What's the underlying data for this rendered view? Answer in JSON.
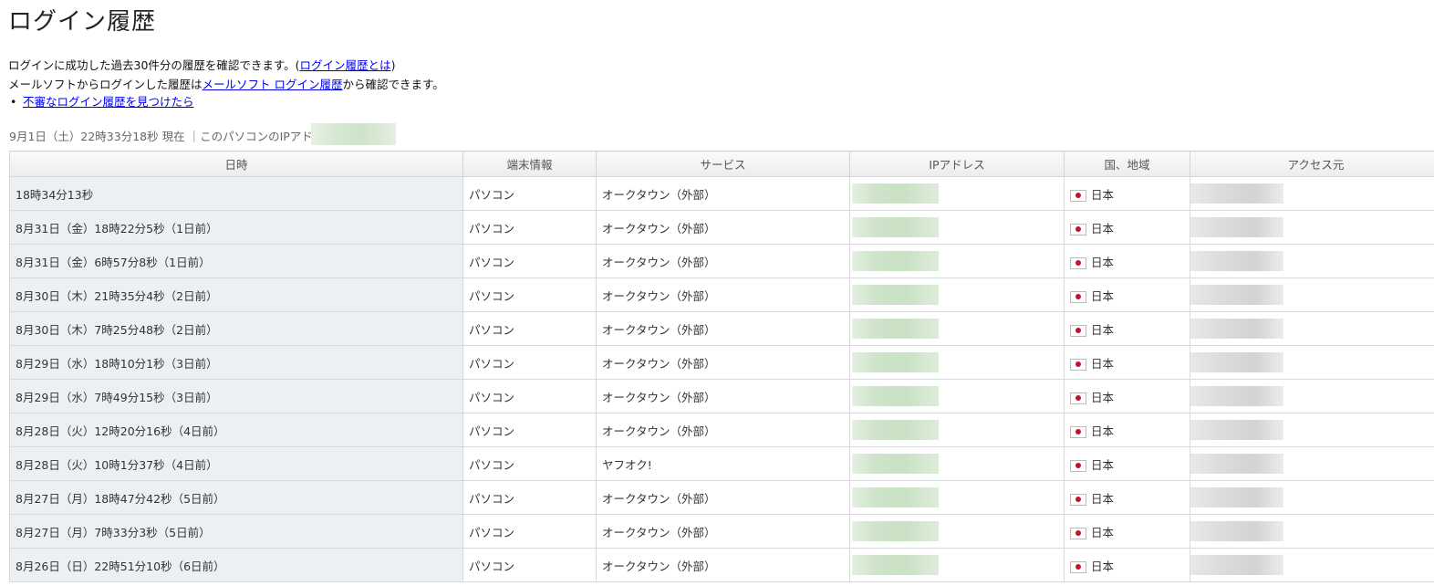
{
  "page_title": "ログイン履歴",
  "intro": {
    "line1_text": "ログインに成功した過去30件分の履歴を確認できます。(",
    "line1_link": "ログイン履歴とは",
    "line1_end": ")",
    "line2_text": "メールソフトからログインした履歴は",
    "line2_link": "メールソフト ログイン履歴",
    "line2_end": "から確認できます。"
  },
  "bullet_link": "不審なログイン履歴を見つけたら",
  "status_line": "9月1日（土）22時33分18秒 現在 ｜このパソコンのIPアドレス：",
  "table": {
    "headers": [
      "日時",
      "端末情報",
      "サービス",
      "IPアドレス",
      "国、地域",
      "アクセス元"
    ],
    "rows": [
      {
        "datetime": "18時34分13秒",
        "device": "パソコン",
        "service": "オークタウン（外部）",
        "country": "日本"
      },
      {
        "datetime": "8月31日（金）18時22分5秒（1日前）",
        "device": "パソコン",
        "service": "オークタウン（外部）",
        "country": "日本"
      },
      {
        "datetime": "8月31日（金）6時57分8秒（1日前）",
        "device": "パソコン",
        "service": "オークタウン（外部）",
        "country": "日本"
      },
      {
        "datetime": "8月30日（木）21時35分4秒（2日前）",
        "device": "パソコン",
        "service": "オークタウン（外部）",
        "country": "日本"
      },
      {
        "datetime": "8月30日（木）7時25分48秒（2日前）",
        "device": "パソコン",
        "service": "オークタウン（外部）",
        "country": "日本"
      },
      {
        "datetime": "8月29日（水）18時10分1秒（3日前）",
        "device": "パソコン",
        "service": "オークタウン（外部）",
        "country": "日本"
      },
      {
        "datetime": "8月29日（水）7時49分15秒（3日前）",
        "device": "パソコン",
        "service": "オークタウン（外部）",
        "country": "日本"
      },
      {
        "datetime": "8月28日（火）12時20分16秒（4日前）",
        "device": "パソコン",
        "service": "オークタウン（外部）",
        "country": "日本"
      },
      {
        "datetime": "8月28日（火）10時1分37秒（4日前）",
        "device": "パソコン",
        "service": "ヤフオク!",
        "country": "日本"
      },
      {
        "datetime": "8月27日（月）18時47分42秒（5日前）",
        "device": "パソコン",
        "service": "オークタウン（外部）",
        "country": "日本"
      },
      {
        "datetime": "8月27日（月）7時33分3秒（5日前）",
        "device": "パソコン",
        "service": "オークタウン（外部）",
        "country": "日本"
      },
      {
        "datetime": "8月26日（日）22時51分10秒（6日前）",
        "device": "パソコン",
        "service": "オークタウン（外部）",
        "country": "日本"
      }
    ]
  },
  "colors": {
    "link": "#0000ee",
    "date_cell_bg": "#edf0f3",
    "flag_red": "#c8102e"
  }
}
